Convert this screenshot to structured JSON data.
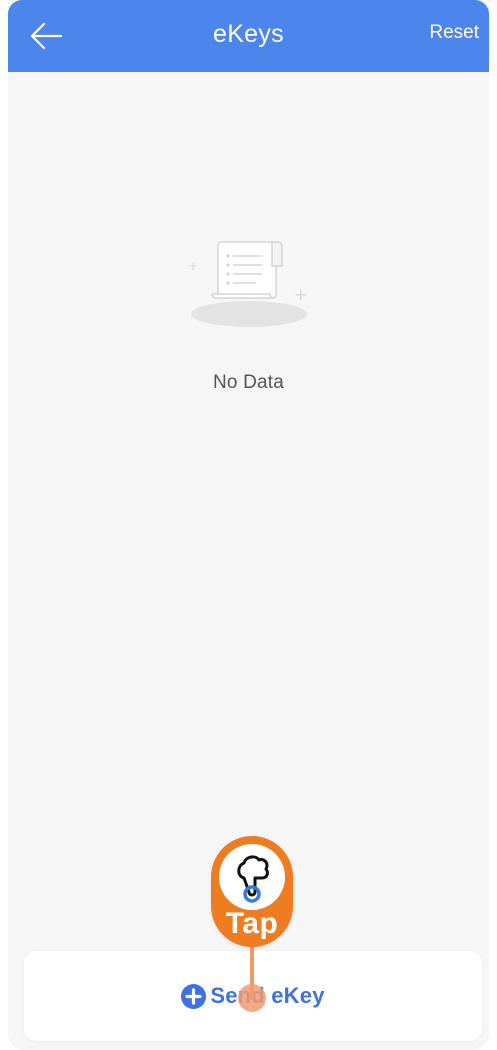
{
  "header": {
    "title": "eKeys",
    "reset_label": "Reset",
    "back_icon": "arrow-left-icon",
    "background_color": "#4c86ec"
  },
  "empty_state": {
    "icon": "empty-document-icon",
    "text": "No Data"
  },
  "bottom_bar": {
    "send_icon": "plus-circle-icon",
    "send_label": "Send eKey",
    "accent_color": "#3f72e0"
  },
  "tap_guide": {
    "icon": "hand-pointer-icon",
    "label": "Tap",
    "color": "#ee7d22"
  }
}
